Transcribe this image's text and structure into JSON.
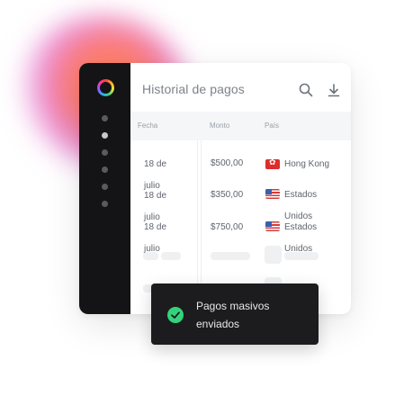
{
  "header": {
    "title": "Historial de pagos"
  },
  "icons": {
    "search": "search-icon",
    "download": "download-icon",
    "logo": "ring-logo-icon",
    "check": "check-icon"
  },
  "table": {
    "columns": [
      "Fecha",
      "Monto",
      "País"
    ],
    "dates": [
      "18 de",
      "julio",
      "18 de",
      "julio",
      "18 de",
      "julio"
    ],
    "amounts": [
      "$500,00",
      "$350,00",
      "$750,00"
    ],
    "countries": [
      {
        "name": "Hong Kong",
        "flag": "hong-kong-flag"
      },
      {
        "name": "Estados",
        "flag": "us-flag"
      },
      {
        "name": "Unidos",
        "flag": ""
      },
      {
        "name": "Estados",
        "flag": "us-flag"
      },
      {
        "name": "Unidos",
        "flag": ""
      }
    ]
  },
  "toast": {
    "message": "Pagos masivos enviados"
  },
  "colors": {
    "sidebar": "#141416",
    "toast": "#1c1c1e",
    "success": "#34d27b",
    "glow": "#ff8a5c"
  }
}
